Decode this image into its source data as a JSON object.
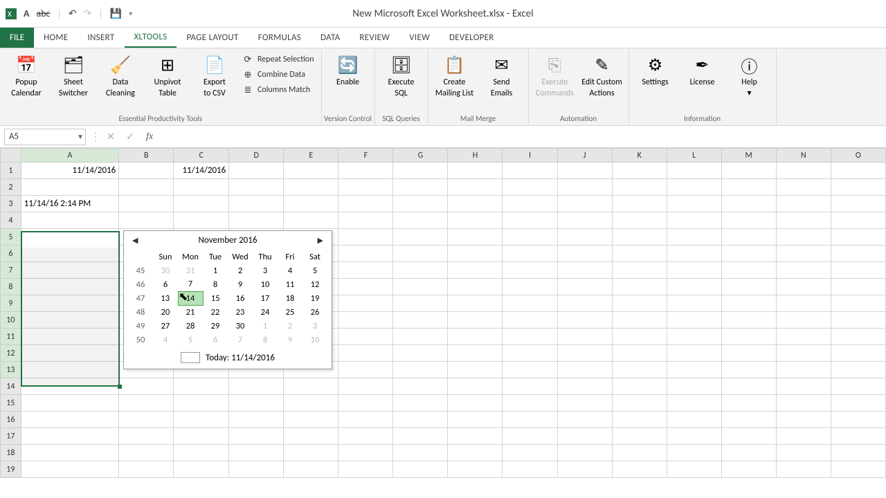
{
  "window": {
    "title": "New Microsoft Excel Worksheet.xlsx - Excel"
  },
  "qat": {
    "bold": "A",
    "strike": "abc"
  },
  "tabs": {
    "file": "FILE",
    "items": [
      {
        "label": "HOME"
      },
      {
        "label": "INSERT"
      },
      {
        "label": "XLTools",
        "active": true
      },
      {
        "label": "PAGE LAYOUT"
      },
      {
        "label": "FORMULAS"
      },
      {
        "label": "DATA"
      },
      {
        "label": "REVIEW"
      },
      {
        "label": "VIEW"
      },
      {
        "label": "DEVELOPER"
      }
    ]
  },
  "ribbon": {
    "groups": [
      {
        "label": "Essential Productivity Tools",
        "big": [
          {
            "name": "popup-calendar",
            "label": "Popup\nCalendar"
          },
          {
            "name": "sheet-switcher",
            "label": "Sheet\nSwitcher"
          },
          {
            "name": "data-cleaning",
            "label": "Data\nCleaning"
          },
          {
            "name": "unpivot-table",
            "label": "Unpivot\nTable"
          },
          {
            "name": "export-csv",
            "label": "Export\nto CSV"
          }
        ],
        "small": [
          {
            "name": "repeat-selection",
            "label": "Repeat Selection"
          },
          {
            "name": "combine-data",
            "label": "Combine Data"
          },
          {
            "name": "columns-match",
            "label": "Columns Match"
          }
        ]
      },
      {
        "label": "Version Control",
        "big": [
          {
            "name": "enable",
            "label": "Enable"
          }
        ]
      },
      {
        "label": "SQL Queries",
        "big": [
          {
            "name": "execute-sql",
            "label": "Execute\nSQL"
          }
        ]
      },
      {
        "label": "Mail Merge",
        "big": [
          {
            "name": "create-mailing-list",
            "label": "Create\nMailing List"
          },
          {
            "name": "send-emails",
            "label": "Send\nEmails"
          }
        ]
      },
      {
        "label": "Automation",
        "big": [
          {
            "name": "execute-commands",
            "label": "Execute\nCommands",
            "disabled": true
          },
          {
            "name": "edit-custom-actions",
            "label": "Edit Custom\nActions"
          }
        ]
      },
      {
        "label": "Information",
        "big": [
          {
            "name": "settings",
            "label": "Settings"
          },
          {
            "name": "license",
            "label": "License"
          },
          {
            "name": "help",
            "label": "Help\n▾"
          }
        ]
      }
    ],
    "icons": {
      "popup-calendar": "📅",
      "sheet-switcher": "🗂",
      "data-cleaning": "🧹",
      "unpivot-table": "⊞",
      "export-csv": "📄",
      "enable": "🔄",
      "execute-sql": "🗄",
      "create-mailing-list": "📋",
      "send-emails": "✉",
      "execute-commands": "⎘",
      "edit-custom-actions": "✎",
      "settings": "⚙",
      "license": "✒",
      "help": "ⓘ",
      "repeat-selection": "⟳",
      "combine-data": "⊕",
      "columns-match": "≣"
    }
  },
  "namebox": {
    "value": "A5"
  },
  "fx_label": "fx",
  "columns": [
    "A",
    "B",
    "C",
    "D",
    "E",
    "F",
    "G",
    "H",
    "I",
    "J",
    "K",
    "L",
    "M",
    "N",
    "O"
  ],
  "rows": 19,
  "cells": {
    "A1": "11/14/2016",
    "C1": "11/14/2016",
    "A3": "11/14/16 2:14 PM"
  },
  "selection": {
    "active": "A5",
    "range_from": "A5",
    "range_to": "A13"
  },
  "picker": {
    "month": "November 2016",
    "wknos": [
      "45",
      "46",
      "47",
      "48",
      "49",
      "50"
    ],
    "days": [
      "Sun",
      "Mon",
      "Tue",
      "Wed",
      "Thu",
      "Fri",
      "Sat"
    ],
    "grid": [
      [
        "30",
        "31",
        "1",
        "2",
        "3",
        "4",
        "5"
      ],
      [
        "6",
        "7",
        "8",
        "9",
        "10",
        "11",
        "12"
      ],
      [
        "13",
        "14",
        "15",
        "16",
        "17",
        "18",
        "19"
      ],
      [
        "20",
        "21",
        "22",
        "23",
        "24",
        "25",
        "26"
      ],
      [
        "27",
        "28",
        "29",
        "30",
        "1",
        "2",
        "3"
      ],
      [
        "4",
        "5",
        "6",
        "7",
        "8",
        "9",
        "10"
      ]
    ],
    "dim_rows_start": [
      0,
      0
    ],
    "today_r": 2,
    "today_c": 1,
    "footer": "Today: 11/14/2016"
  }
}
